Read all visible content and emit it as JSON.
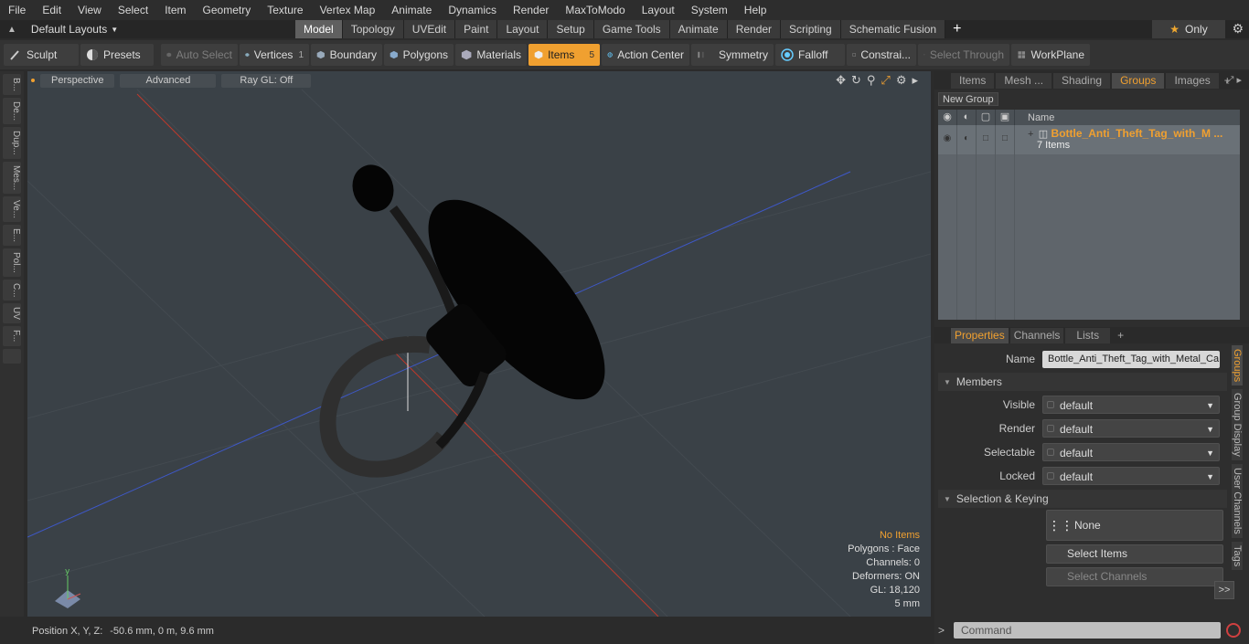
{
  "menu": [
    "File",
    "Edit",
    "View",
    "Select",
    "Item",
    "Geometry",
    "Texture",
    "Vertex Map",
    "Animate",
    "Dynamics",
    "Render",
    "MaxToModo",
    "Layout",
    "System",
    "Help"
  ],
  "layouts_label": "Default Layouts",
  "layout_tabs": [
    {
      "label": "Model",
      "active": true
    },
    {
      "label": "Topology"
    },
    {
      "label": "UVEdit"
    },
    {
      "label": "Paint"
    },
    {
      "label": "Layout"
    },
    {
      "label": "Setup"
    },
    {
      "label": "Game Tools"
    },
    {
      "label": "Animate"
    },
    {
      "label": "Render"
    },
    {
      "label": "Scripting"
    },
    {
      "label": "Schematic Fusion"
    }
  ],
  "only_label": "Only",
  "toolbar": {
    "sculpt": "Sculpt",
    "presets": "Presets",
    "auto_select": "Auto Select",
    "vertices": "Vertices",
    "vertices_count": "1",
    "boundary": "Boundary",
    "polygons": "Polygons",
    "materials": "Materials",
    "items": "Items",
    "items_count": "5",
    "action_center": "Action Center",
    "symmetry": "Symmetry",
    "falloff": "Falloff",
    "constraints": "Constrai...",
    "select_through": "Select Through",
    "workplane": "WorkPlane"
  },
  "left_tabs": [
    "B...",
    "De...",
    "Dup...",
    "Mes...",
    "Ve...",
    "E...",
    "Pol...",
    "C...",
    "UV",
    "F..."
  ],
  "viewport": {
    "view_mode": "Perspective",
    "shading": "Advanced",
    "raygl": "Ray GL: Off",
    "hud": {
      "selection": "No Items",
      "polygons": "Polygons : Face",
      "channels": "Channels: 0",
      "deformers": "Deformers: ON",
      "gl": "GL: 18,120",
      "scale": "5 mm"
    }
  },
  "status": {
    "label": "Position X, Y, Z:",
    "value": "-50.6 mm, 0 m, 9.6 mm"
  },
  "right_tabs": [
    {
      "label": "Items"
    },
    {
      "label": "Mesh ..."
    },
    {
      "label": "Shading"
    },
    {
      "label": "Groups",
      "active": true
    },
    {
      "label": "Images"
    }
  ],
  "groups": {
    "new_group": "New Group",
    "column_name": "Name",
    "rows": [
      {
        "name": "Bottle_Anti_Theft_Tag_with_M ...",
        "sub": "7 Items"
      }
    ]
  },
  "prop_tabs": [
    {
      "label": "Properties",
      "active": true
    },
    {
      "label": "Channels"
    },
    {
      "label": "Lists"
    }
  ],
  "properties": {
    "name_label": "Name",
    "name_value": "Bottle_Anti_Theft_Tag_with_Metal_Ca",
    "members_section": "Members",
    "visible_label": "Visible",
    "visible_value": "default",
    "render_label": "Render",
    "render_value": "default",
    "selectable_label": "Selectable",
    "selectable_value": "default",
    "locked_label": "Locked",
    "locked_value": "default",
    "keying_section": "Selection & Keying",
    "none_label": "None",
    "select_items": "Select Items",
    "select_channels": "Select Channels",
    "more": ">>"
  },
  "side_tabs": [
    {
      "label": "Groups",
      "active": true
    },
    {
      "label": "Group Display"
    },
    {
      "label": "User Channels"
    },
    {
      "label": "Tags"
    }
  ],
  "command_placeholder": "Command",
  "colors": {
    "accent": "#f0a030",
    "viewport_bg": "#3a4147"
  }
}
